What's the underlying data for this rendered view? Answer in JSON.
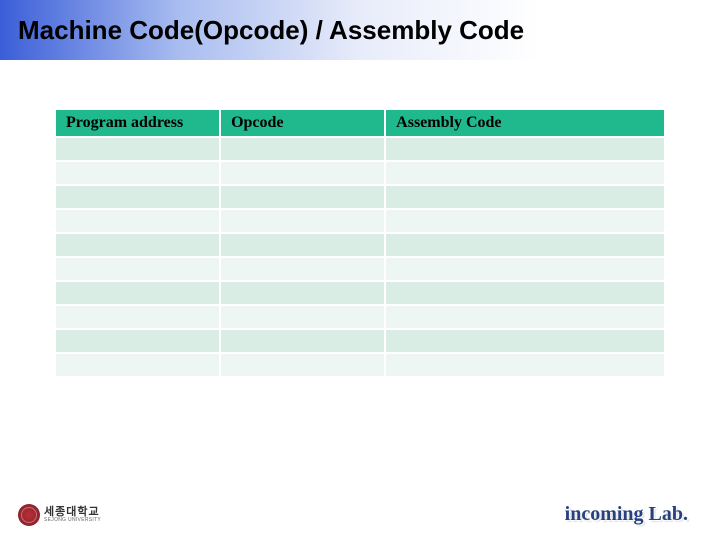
{
  "title": "Machine Code(Opcode) / Assembly Code",
  "table": {
    "headers": {
      "col1": "Program address",
      "col2": "Opcode",
      "col3": "Assembly Code"
    },
    "rows": [
      {
        "addr": "",
        "op": "",
        "asm": ""
      },
      {
        "addr": "",
        "op": "",
        "asm": ""
      },
      {
        "addr": "",
        "op": "",
        "asm": ""
      },
      {
        "addr": "",
        "op": "",
        "asm": ""
      },
      {
        "addr": "",
        "op": "",
        "asm": ""
      },
      {
        "addr": "",
        "op": "",
        "asm": ""
      },
      {
        "addr": "",
        "op": "",
        "asm": ""
      },
      {
        "addr": "",
        "op": "",
        "asm": ""
      },
      {
        "addr": "",
        "op": "",
        "asm": ""
      },
      {
        "addr": "",
        "op": "",
        "asm": ""
      }
    ]
  },
  "footer": {
    "logo_kr": "세종대학교",
    "logo_en": "SEJONG UNIVERSITY",
    "lab": "incoming Lab."
  }
}
